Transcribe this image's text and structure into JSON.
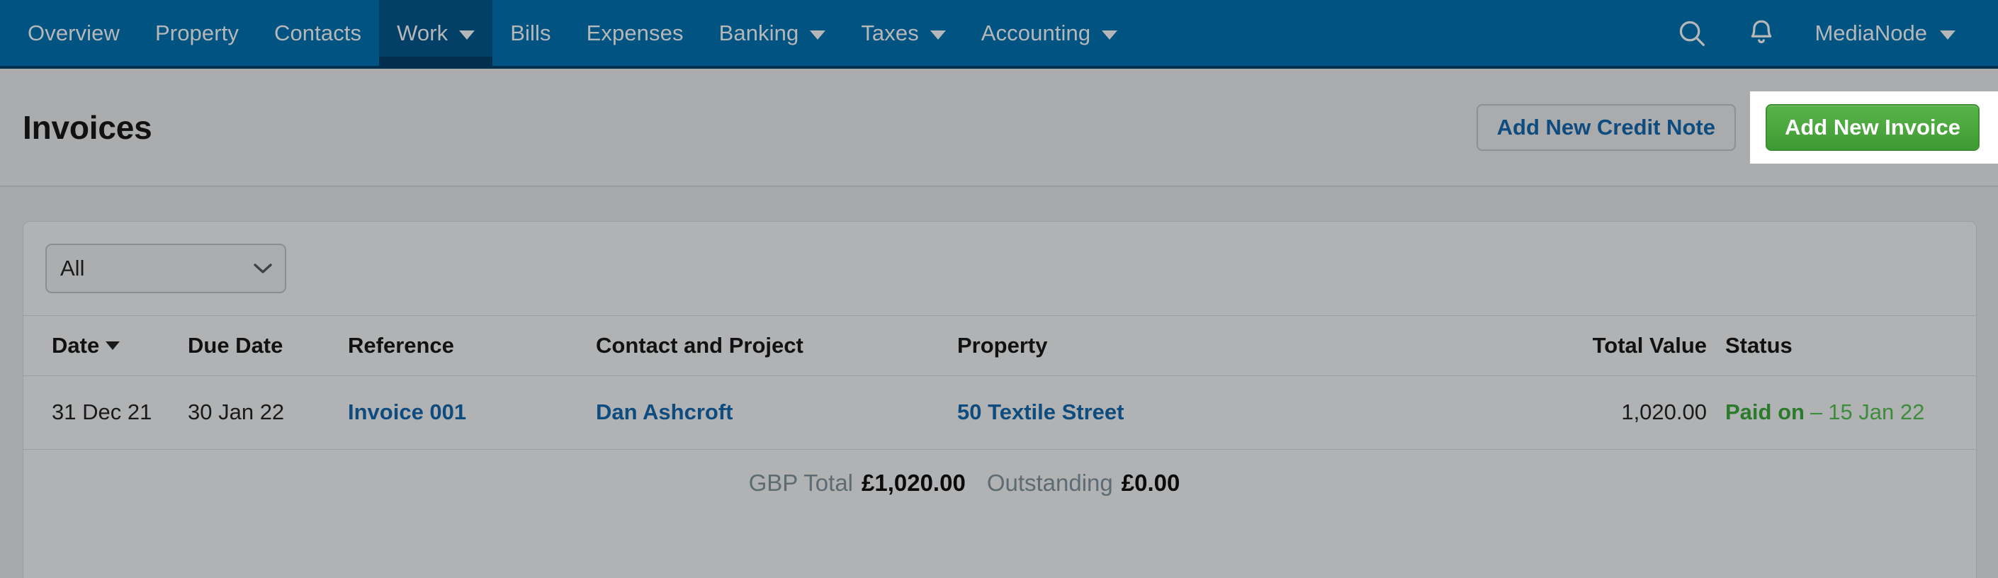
{
  "navbar": {
    "items": [
      {
        "label": "Overview",
        "has_caret": false,
        "active": false
      },
      {
        "label": "Property",
        "has_caret": false,
        "active": false
      },
      {
        "label": "Contacts",
        "has_caret": false,
        "active": false
      },
      {
        "label": "Work",
        "has_caret": true,
        "active": true
      },
      {
        "label": "Bills",
        "has_caret": false,
        "active": false
      },
      {
        "label": "Expenses",
        "has_caret": false,
        "active": false
      },
      {
        "label": "Banking",
        "has_caret": true,
        "active": false
      },
      {
        "label": "Taxes",
        "has_caret": true,
        "active": false
      },
      {
        "label": "Accounting",
        "has_caret": true,
        "active": false
      }
    ],
    "search_icon": "search-icon",
    "notifications_icon": "bell-icon",
    "user": "MediaNode",
    "brand_color": "#015381",
    "active_tab_color": "#024068"
  },
  "header": {
    "title": "Invoices",
    "credit_note_button": "Add New Credit Note",
    "invoice_button": "Add New Invoice",
    "primary_color": "#4aa83d",
    "link_color": "#0e4c7f"
  },
  "filter": {
    "selected": "All",
    "options": [
      "All"
    ]
  },
  "table": {
    "columns": [
      {
        "label": "Date",
        "sorted": true,
        "sort_dir": "desc"
      },
      {
        "label": "Due Date",
        "sorted": false
      },
      {
        "label": "Reference",
        "sorted": false
      },
      {
        "label": "Contact and Project",
        "sorted": false
      },
      {
        "label": "Property",
        "sorted": false
      },
      {
        "label": "Total Value",
        "sorted": false
      },
      {
        "label": "Status",
        "sorted": false
      }
    ],
    "rows": [
      {
        "date": "31 Dec 21",
        "due_date": "30 Jan 22",
        "reference": "Invoice 001",
        "contact": "Dan Ashcroft",
        "property": "50 Textile Street",
        "total_value": "1,020.00",
        "status_label": "Paid on",
        "status_sep": "–",
        "status_date": "15 Jan 22",
        "status_color": "#2c7a2c"
      }
    ]
  },
  "totals": {
    "currency_label": "GBP Total",
    "currency_value": "£1,020.00",
    "outstanding_label": "Outstanding",
    "outstanding_value": "£0.00"
  }
}
